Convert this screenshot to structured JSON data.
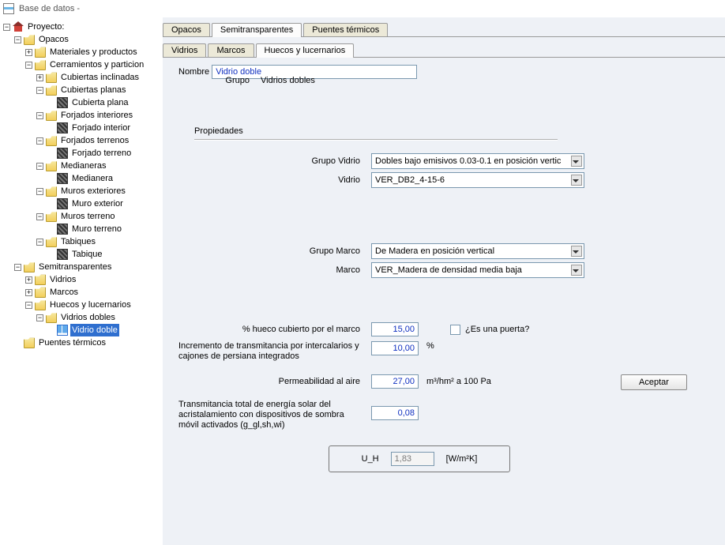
{
  "window": {
    "title": "Base de datos -"
  },
  "tree": {
    "root": "Proyecto:",
    "opacos": {
      "label": "Opacos",
      "materiales": "Materiales y productos",
      "cerramientos": "Cerramientos y particion",
      "cubiertas_inclinadas": "Cubiertas inclinadas",
      "cubiertas_planas": "Cubiertas planas",
      "cubierta_plana": "Cubierta plana",
      "forjados_interiores": "Forjados interiores",
      "forjado_interior": "Forjado interior",
      "forjados_terrenos": "Forjados terrenos",
      "forjado_terreno": "Forjado terreno",
      "medianeras": "Medianeras",
      "medianera": "Medianera",
      "muros_exteriores": "Muros exteriores",
      "muro_exterior": "Muro exterior",
      "muros_terreno": "Muros terreno",
      "muro_terreno": "Muro terreno",
      "tabiques": "Tabiques",
      "tabique": "Tabique"
    },
    "semitransparentes": {
      "label": "Semitransparentes",
      "vidrios": "Vidrios",
      "marcos": "Marcos",
      "huecos": "Huecos y lucernarios",
      "vidrios_dobles": "Vidrios dobles",
      "vidrio_doble": "Vidrio doble"
    },
    "puentes": "Puentes térmicos"
  },
  "tabs_main": {
    "opacos": "Opacos",
    "semi": "Semitransparentes",
    "puentes": "Puentes térmicos"
  },
  "tabs_sub": {
    "vidrios": "Vidrios",
    "marcos": "Marcos",
    "huecos": "Huecos y lucernarios"
  },
  "form": {
    "grupo_label": "Grupo",
    "grupo_value": "Vidrios dobles",
    "nombre_label": "Nombre",
    "nombre_value": "Vidrio doble",
    "propiedades": "Propiedades",
    "grupo_vidrio_label": "Grupo Vidrio",
    "grupo_vidrio_value": "Dobles bajo emisivos 0.03-0.1 en posición vertic",
    "vidrio_label": "Vidrio",
    "vidrio_value": "VER_DB2_4-15-6",
    "grupo_marco_label": "Grupo Marco",
    "grupo_marco_value": "De Madera en posición vertical",
    "marco_label": "Marco",
    "marco_value": "VER_Madera de densidad media baja",
    "pct_hueco_label": "% hueco cubierto por el marco",
    "pct_hueco_value": "15,00",
    "puerta_label": "¿Es una puerta?",
    "incremento_label": "Incremento de transmitancia por intercalarios y cajones de persiana integrados",
    "incremento_value": "10,00",
    "incremento_unit": "%",
    "permeabilidad_label": "Permeabilidad al aire",
    "permeabilidad_value": "27,00",
    "permeabilidad_unit": "m³/hm² a 100 Pa",
    "ggl_label": "Transmitancia total de energía solar del acristalamiento con dispositivos de sombra móvil activados (g_gl,sh,wi)",
    "ggl_value": "0,08",
    "uh_label": "U_H",
    "uh_value": "1,83",
    "uh_unit": "[W/m²K]",
    "aceptar": "Aceptar"
  }
}
